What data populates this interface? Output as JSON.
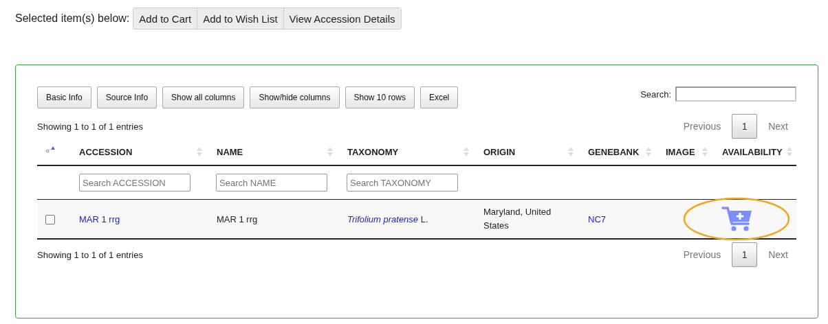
{
  "selection_bar": {
    "label": "Selected item(s) below:",
    "buttons": [
      "Add to Cart",
      "Add to Wish List",
      "View Accession Details"
    ]
  },
  "toolbar": {
    "buttons": [
      "Basic Info",
      "Source Info",
      "Show all columns",
      "Show/hide columns",
      "Show 10 rows",
      "Excel"
    ],
    "search_label": "Search:"
  },
  "info_top": "Showing 1 to 1 of 1 entries",
  "pagination_top": {
    "previous": "Previous",
    "pages": [
      {
        "label": "1",
        "selected": true
      }
    ],
    "next": "Next"
  },
  "table": {
    "columns": [
      {
        "sorted_ascending": true
      },
      {
        "label": "ACCESSION",
        "sorted_ascending": false,
        "filter": {
          "placeholder": "Search ACCESSION"
        }
      },
      {
        "label": "NAME",
        "sorted_ascending": false,
        "filter": {
          "placeholder": "Search NAME"
        }
      },
      {
        "label": "TAXONOMY",
        "sorted_ascending": false,
        "filter": {
          "placeholder": "Search TAXONOMY"
        }
      },
      {
        "label": "ORIGIN",
        "sorted_ascending": false
      },
      {
        "label": "GENEBANK",
        "sorted_ascending": false
      },
      {
        "label": "IMAGE",
        "sorted_ascending": false
      },
      {
        "label": "AVAILABILITY",
        "sorted_ascending": false
      }
    ],
    "rows": [
      {
        "checked": false,
        "accession": "MAR 1 rrg",
        "name": "MAR 1 rrg",
        "taxonomy": "*Trifolium pratense* L.",
        "origin": "Maryland, United States",
        "genebank": "NC7",
        "availability": {
          "kind": "cart",
          "highlighted": true
        }
      }
    ]
  },
  "info_bottom": "Showing 1 to 1 of 1 entries",
  "pagination_bottom": {
    "previous": "Previous",
    "pages": [
      {
        "label": "1",
        "selected": true
      }
    ],
    "next": "Next"
  }
}
